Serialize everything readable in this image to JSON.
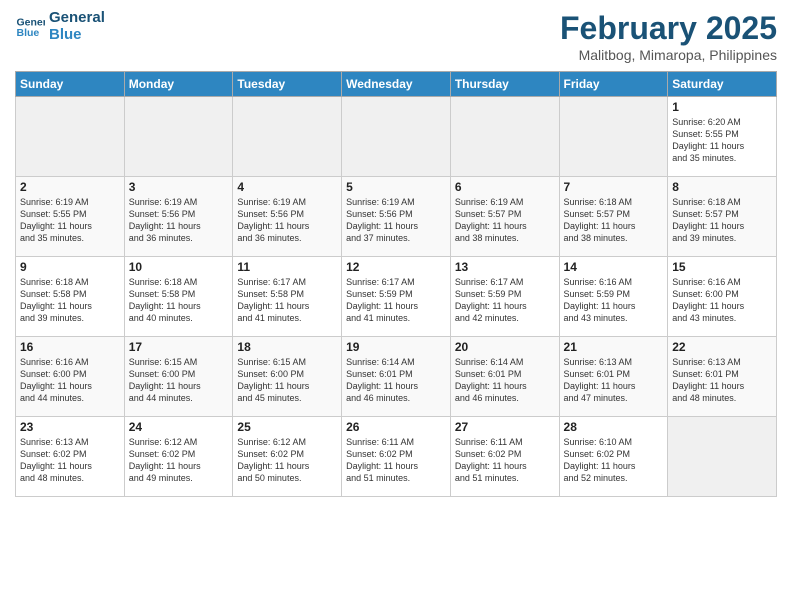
{
  "logo": {
    "line1": "General",
    "line2": "Blue"
  },
  "title": "February 2025",
  "subtitle": "Malitbog, Mimaropa, Philippines",
  "days_of_week": [
    "Sunday",
    "Monday",
    "Tuesday",
    "Wednesday",
    "Thursday",
    "Friday",
    "Saturday"
  ],
  "weeks": [
    [
      {
        "day": "",
        "info": ""
      },
      {
        "day": "",
        "info": ""
      },
      {
        "day": "",
        "info": ""
      },
      {
        "day": "",
        "info": ""
      },
      {
        "day": "",
        "info": ""
      },
      {
        "day": "",
        "info": ""
      },
      {
        "day": "1",
        "info": "Sunrise: 6:20 AM\nSunset: 5:55 PM\nDaylight: 11 hours\nand 35 minutes."
      }
    ],
    [
      {
        "day": "2",
        "info": "Sunrise: 6:19 AM\nSunset: 5:55 PM\nDaylight: 11 hours\nand 35 minutes."
      },
      {
        "day": "3",
        "info": "Sunrise: 6:19 AM\nSunset: 5:56 PM\nDaylight: 11 hours\nand 36 minutes."
      },
      {
        "day": "4",
        "info": "Sunrise: 6:19 AM\nSunset: 5:56 PM\nDaylight: 11 hours\nand 36 minutes."
      },
      {
        "day": "5",
        "info": "Sunrise: 6:19 AM\nSunset: 5:56 PM\nDaylight: 11 hours\nand 37 minutes."
      },
      {
        "day": "6",
        "info": "Sunrise: 6:19 AM\nSunset: 5:57 PM\nDaylight: 11 hours\nand 38 minutes."
      },
      {
        "day": "7",
        "info": "Sunrise: 6:18 AM\nSunset: 5:57 PM\nDaylight: 11 hours\nand 38 minutes."
      },
      {
        "day": "8",
        "info": "Sunrise: 6:18 AM\nSunset: 5:57 PM\nDaylight: 11 hours\nand 39 minutes."
      }
    ],
    [
      {
        "day": "9",
        "info": "Sunrise: 6:18 AM\nSunset: 5:58 PM\nDaylight: 11 hours\nand 39 minutes."
      },
      {
        "day": "10",
        "info": "Sunrise: 6:18 AM\nSunset: 5:58 PM\nDaylight: 11 hours\nand 40 minutes."
      },
      {
        "day": "11",
        "info": "Sunrise: 6:17 AM\nSunset: 5:58 PM\nDaylight: 11 hours\nand 41 minutes."
      },
      {
        "day": "12",
        "info": "Sunrise: 6:17 AM\nSunset: 5:59 PM\nDaylight: 11 hours\nand 41 minutes."
      },
      {
        "day": "13",
        "info": "Sunrise: 6:17 AM\nSunset: 5:59 PM\nDaylight: 11 hours\nand 42 minutes."
      },
      {
        "day": "14",
        "info": "Sunrise: 6:16 AM\nSunset: 5:59 PM\nDaylight: 11 hours\nand 43 minutes."
      },
      {
        "day": "15",
        "info": "Sunrise: 6:16 AM\nSunset: 6:00 PM\nDaylight: 11 hours\nand 43 minutes."
      }
    ],
    [
      {
        "day": "16",
        "info": "Sunrise: 6:16 AM\nSunset: 6:00 PM\nDaylight: 11 hours\nand 44 minutes."
      },
      {
        "day": "17",
        "info": "Sunrise: 6:15 AM\nSunset: 6:00 PM\nDaylight: 11 hours\nand 44 minutes."
      },
      {
        "day": "18",
        "info": "Sunrise: 6:15 AM\nSunset: 6:00 PM\nDaylight: 11 hours\nand 45 minutes."
      },
      {
        "day": "19",
        "info": "Sunrise: 6:14 AM\nSunset: 6:01 PM\nDaylight: 11 hours\nand 46 minutes."
      },
      {
        "day": "20",
        "info": "Sunrise: 6:14 AM\nSunset: 6:01 PM\nDaylight: 11 hours\nand 46 minutes."
      },
      {
        "day": "21",
        "info": "Sunrise: 6:13 AM\nSunset: 6:01 PM\nDaylight: 11 hours\nand 47 minutes."
      },
      {
        "day": "22",
        "info": "Sunrise: 6:13 AM\nSunset: 6:01 PM\nDaylight: 11 hours\nand 48 minutes."
      }
    ],
    [
      {
        "day": "23",
        "info": "Sunrise: 6:13 AM\nSunset: 6:02 PM\nDaylight: 11 hours\nand 48 minutes."
      },
      {
        "day": "24",
        "info": "Sunrise: 6:12 AM\nSunset: 6:02 PM\nDaylight: 11 hours\nand 49 minutes."
      },
      {
        "day": "25",
        "info": "Sunrise: 6:12 AM\nSunset: 6:02 PM\nDaylight: 11 hours\nand 50 minutes."
      },
      {
        "day": "26",
        "info": "Sunrise: 6:11 AM\nSunset: 6:02 PM\nDaylight: 11 hours\nand 51 minutes."
      },
      {
        "day": "27",
        "info": "Sunrise: 6:11 AM\nSunset: 6:02 PM\nDaylight: 11 hours\nand 51 minutes."
      },
      {
        "day": "28",
        "info": "Sunrise: 6:10 AM\nSunset: 6:02 PM\nDaylight: 11 hours\nand 52 minutes."
      },
      {
        "day": "",
        "info": ""
      }
    ]
  ]
}
